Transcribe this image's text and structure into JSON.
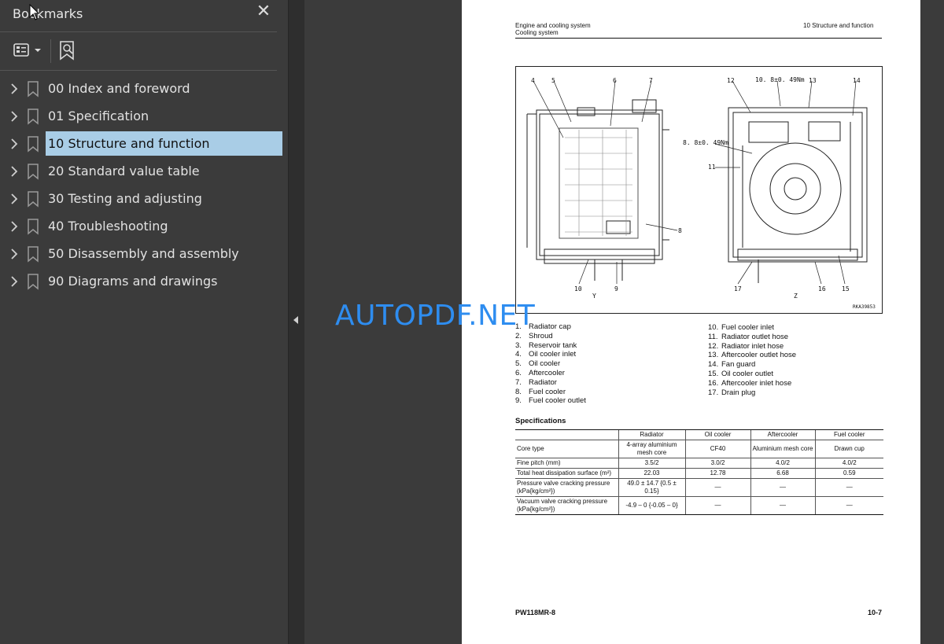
{
  "sidebar": {
    "title": "Bookmarks",
    "close_icon": "close-icon",
    "items": [
      {
        "label": "00 Index and foreword"
      },
      {
        "label": "01 Specification"
      },
      {
        "label": "10 Structure and function"
      },
      {
        "label": "20 Standard value table"
      },
      {
        "label": "30 Testing and adjusting"
      },
      {
        "label": "40 Troubleshooting"
      },
      {
        "label": "50 Disassembly and assembly"
      },
      {
        "label": "90 Diagrams and drawings"
      }
    ],
    "selected_index": 2
  },
  "page": {
    "header_left_1": "Engine and cooling system",
    "header_left_2": "Cooling system",
    "header_right": "10 Structure and function",
    "figure": {
      "labels": [
        "4",
        "5",
        "6",
        "7",
        "12",
        "10. 8±0. 49Nm",
        "13",
        "14",
        "8. 8±0. 49Nm",
        "11",
        "8",
        "10",
        "9",
        "17",
        "16",
        "15",
        "Y",
        "Z",
        "RKA39853"
      ]
    },
    "legend_left": [
      {
        "n": "1.",
        "t": "Radiator cap"
      },
      {
        "n": "2.",
        "t": "Shroud"
      },
      {
        "n": "3.",
        "t": "Reservoir tank"
      },
      {
        "n": "4.",
        "t": "Oil cooler inlet"
      },
      {
        "n": "5.",
        "t": "Oil cooler"
      },
      {
        "n": "6.",
        "t": "Aftercooler"
      },
      {
        "n": "7.",
        "t": "Radiator"
      },
      {
        "n": "8.",
        "t": "Fuel cooler"
      },
      {
        "n": "9.",
        "t": "Fuel cooler outlet"
      }
    ],
    "legend_right": [
      {
        "n": "10.",
        "t": "Fuel cooler inlet"
      },
      {
        "n": "11.",
        "t": "Radiator outlet hose"
      },
      {
        "n": "12.",
        "t": "Radiator inlet hose"
      },
      {
        "n": "13.",
        "t": "Aftercooler outlet hose"
      },
      {
        "n": "14.",
        "t": "Fan guard"
      },
      {
        "n": "15.",
        "t": "Oil cooler outlet"
      },
      {
        "n": "16.",
        "t": "Aftercooler inlet hose"
      },
      {
        "n": "17.",
        "t": "Drain plug"
      }
    ],
    "spec_title": "Specifications",
    "spec_table": {
      "headers": [
        "",
        "Radiator",
        "Oil cooler",
        "Aftercooler",
        "Fuel cooler"
      ],
      "rows": [
        [
          "Core type",
          "4-array aluminium mesh core",
          "CF40",
          "Aluminium mesh core",
          "Drawn cup"
        ],
        [
          "Fine pitch (mm)",
          "3.5/2",
          "3.0/2",
          "4.0/2",
          "4.0/2"
        ],
        [
          "Total heat dissipation surface (m²)",
          "22.03",
          "12.78",
          "6.68",
          "0.59"
        ],
        [
          "Pressure valve cracking pressure (kPa{kg/cm²})",
          "49.0 ± 14.7 {0.5 ± 0.15}",
          "—",
          "—",
          "—"
        ],
        [
          "Vacuum valve cracking pressure (kPa{kg/cm²})",
          "-4.9 – 0 {-0.05 – 0}",
          "—",
          "—",
          "—"
        ]
      ]
    },
    "footer_left": "PW118MR-8",
    "footer_right": "10-7"
  },
  "watermark": "AUTOPDF.NET",
  "colors": {
    "selected_bg": "#a9cde6",
    "watermark": "#2e8df0",
    "app_bg": "#3b3b3b"
  }
}
